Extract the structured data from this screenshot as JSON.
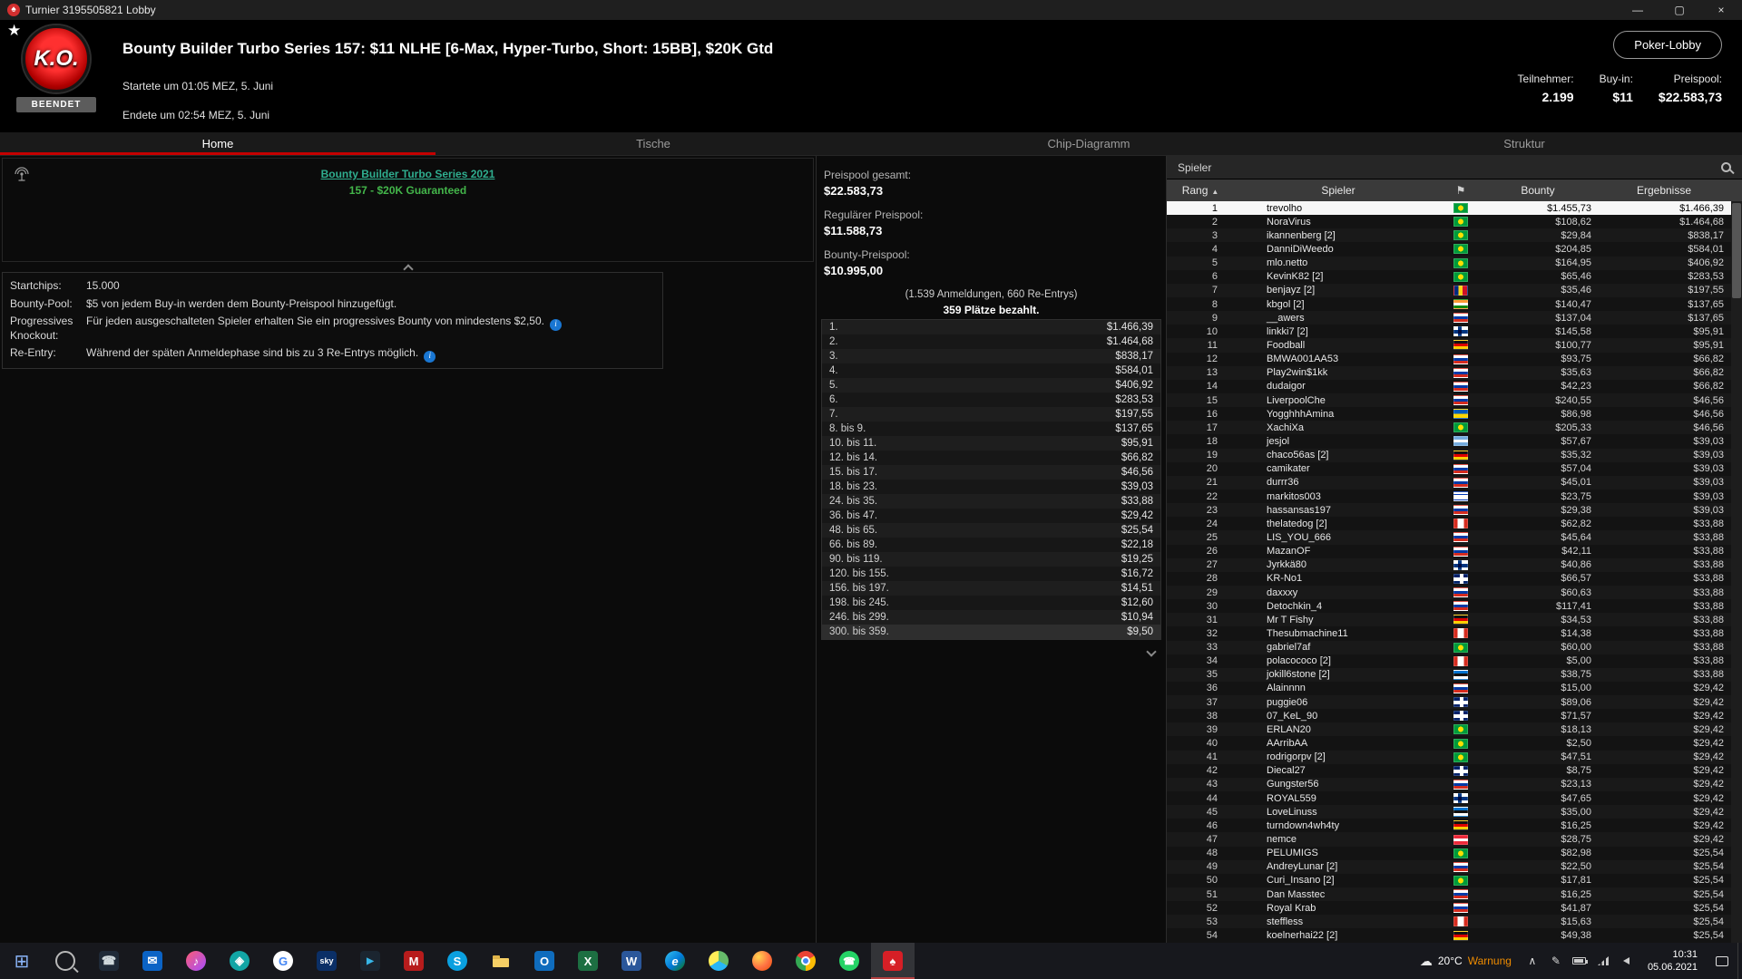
{
  "titlebar": {
    "title": "Turnier 3195505821 Lobby",
    "minimize": "—",
    "maximize": "▢",
    "close": "×"
  },
  "header": {
    "logo_text": "K.O.",
    "badge": "BEENDET",
    "title": "Bounty Builder Turbo Series 157: $11 NLHE [6-Max, Hyper-Turbo, Short: 15BB], $20K Gtd",
    "started": "Startete um 01:05 MEZ, 5. Juni",
    "ended": "Endete um 02:54 MEZ, 5. Juni",
    "lobby_button": "Poker-Lobby",
    "stats": [
      {
        "label": "Teilnehmer:",
        "value": "2.199"
      },
      {
        "label": "Buy-in:",
        "value": "$11"
      },
      {
        "label": "Preispool:",
        "value": "$22.583,73"
      }
    ]
  },
  "tabs": [
    {
      "label": "Home",
      "active": true
    },
    {
      "label": "Tische",
      "active": false
    },
    {
      "label": "Chip-Diagramm",
      "active": false
    },
    {
      "label": "Struktur",
      "active": false
    }
  ],
  "ad": {
    "line1": "Bounty Builder Turbo Series 2021",
    "line2": "157 - $20K Guaranteed"
  },
  "info": {
    "rows": [
      {
        "label": "Startchips:",
        "value": "15.000",
        "info": false
      },
      {
        "label": "Bounty-Pool:",
        "value": "$5 von jedem Buy-in werden dem Bounty-Preispool hinzugefügt.",
        "info": false
      },
      {
        "label": "Progressives Knockout:",
        "value": "Für jeden ausgeschalteten Spieler erhalten Sie ein progressives Bounty von mindestens $2,50.",
        "info": true
      },
      {
        "label": "Re-Entry:",
        "value": "Während der späten Anmeldephase sind bis zu 3 Re-Entrys möglich.",
        "info": true
      }
    ]
  },
  "prizepool": {
    "total_label": "Preispool gesamt:",
    "total": "$22.583,73",
    "regular_label": "Regulärer Preispool:",
    "regular": "$11.588,73",
    "bounty_label": "Bounty-Preispool:",
    "bounty": "$10.995,00",
    "entries": "(1.539 Anmeldungen, 660 Re-Entrys)",
    "paid": "359 Plätze bezahlt.",
    "payouts": [
      {
        "place": "1.",
        "amount": "$1.466,39"
      },
      {
        "place": "2.",
        "amount": "$1.464,68"
      },
      {
        "place": "3.",
        "amount": "$838,17"
      },
      {
        "place": "4.",
        "amount": "$584,01"
      },
      {
        "place": "5.",
        "amount": "$406,92"
      },
      {
        "place": "6.",
        "amount": "$283,53"
      },
      {
        "place": "7.",
        "amount": "$197,55"
      },
      {
        "place": "8. bis 9.",
        "amount": "$137,65"
      },
      {
        "place": "10. bis 11.",
        "amount": "$95,91"
      },
      {
        "place": "12. bis 14.",
        "amount": "$66,82"
      },
      {
        "place": "15. bis 17.",
        "amount": "$46,56"
      },
      {
        "place": "18. bis 23.",
        "amount": "$39,03"
      },
      {
        "place": "24. bis 35.",
        "amount": "$33,88"
      },
      {
        "place": "36. bis 47.",
        "amount": "$29,42"
      },
      {
        "place": "48. bis 65.",
        "amount": "$25,54"
      },
      {
        "place": "66. bis 89.",
        "amount": "$22,18"
      },
      {
        "place": "90. bis 119.",
        "amount": "$19,25"
      },
      {
        "place": "120. bis 155.",
        "amount": "$16,72"
      },
      {
        "place": "156. bis 197.",
        "amount": "$14,51"
      },
      {
        "place": "198. bis 245.",
        "amount": "$12,60"
      },
      {
        "place": "246. bis 299.",
        "amount": "$10,94"
      },
      {
        "place": "300. bis 359.",
        "amount": "$9,50",
        "highlight": true
      }
    ]
  },
  "players": {
    "panel_title": "Spieler",
    "columns": {
      "rank": "Rang",
      "player": "Spieler",
      "bounty": "Bounty",
      "results": "Ergebnisse"
    },
    "rows": [
      {
        "rank": 1,
        "name": "trevolho",
        "flag": "br",
        "bounty": "$1.455,73",
        "result": "$1.466,39",
        "selected": true
      },
      {
        "rank": 2,
        "name": "NoraVirus",
        "flag": "br",
        "bounty": "$108,62",
        "result": "$1.464,68"
      },
      {
        "rank": 3,
        "name": "ikannenberg [2]",
        "flag": "br",
        "bounty": "$29,84",
        "result": "$838,17"
      },
      {
        "rank": 4,
        "name": "DanniDiWeedo",
        "flag": "br",
        "bounty": "$204,85",
        "result": "$584,01"
      },
      {
        "rank": 5,
        "name": "mlo.netto",
        "flag": "br",
        "bounty": "$164,95",
        "result": "$406,92"
      },
      {
        "rank": 6,
        "name": "KevinK82 [2]",
        "flag": "br",
        "bounty": "$65,46",
        "result": "$283,53"
      },
      {
        "rank": 7,
        "name": "benjayz [2]",
        "flag": "ro",
        "bounty": "$35,46",
        "result": "$197,55"
      },
      {
        "rank": 8,
        "name": "kbgol [2]",
        "flag": "in",
        "bounty": "$140,47",
        "result": "$137,65"
      },
      {
        "rank": 9,
        "name": "__awers",
        "flag": "ru",
        "bounty": "$137,04",
        "result": "$137,65"
      },
      {
        "rank": 10,
        "name": "linkki7 [2]",
        "flag": "fi",
        "bounty": "$145,58",
        "result": "$95,91"
      },
      {
        "rank": 11,
        "name": "Foodball",
        "flag": "de",
        "bounty": "$100,77",
        "result": "$95,91"
      },
      {
        "rank": 12,
        "name": "BMWA001AA53",
        "flag": "ru",
        "bounty": "$93,75",
        "result": "$66,82"
      },
      {
        "rank": 13,
        "name": "Play2win$1kk",
        "flag": "ru",
        "bounty": "$35,63",
        "result": "$66,82"
      },
      {
        "rank": 14,
        "name": "dudaigor",
        "flag": "ru",
        "bounty": "$42,23",
        "result": "$66,82"
      },
      {
        "rank": 15,
        "name": "LiverpoolChe",
        "flag": "ru",
        "bounty": "$240,55",
        "result": "$46,56"
      },
      {
        "rank": 16,
        "name": "YogghhhAmina",
        "flag": "ua",
        "bounty": "$86,98",
        "result": "$46,56"
      },
      {
        "rank": 17,
        "name": "XachiXa",
        "flag": "br",
        "bounty": "$205,33",
        "result": "$46,56"
      },
      {
        "rank": 18,
        "name": "jesjol",
        "flag": "ar",
        "bounty": "$57,67",
        "result": "$39,03"
      },
      {
        "rank": 19,
        "name": "chaco56as [2]",
        "flag": "de",
        "bounty": "$35,32",
        "result": "$39,03"
      },
      {
        "rank": 20,
        "name": "camikater",
        "flag": "ru",
        "bounty": "$57,04",
        "result": "$39,03"
      },
      {
        "rank": 21,
        "name": "durrr36",
        "flag": "ru",
        "bounty": "$45,01",
        "result": "$39,03"
      },
      {
        "rank": 22,
        "name": "markitos003",
        "flag": "il",
        "bounty": "$23,75",
        "result": "$39,03"
      },
      {
        "rank": 23,
        "name": "hassansas197",
        "flag": "ru",
        "bounty": "$29,38",
        "result": "$39,03"
      },
      {
        "rank": 24,
        "name": "thelatedog [2]",
        "flag": "ca",
        "bounty": "$62,82",
        "result": "$33,88"
      },
      {
        "rank": 25,
        "name": "LIS_YOU_666",
        "flag": "ru",
        "bounty": "$45,64",
        "result": "$33,88"
      },
      {
        "rank": 26,
        "name": "MazanOF",
        "flag": "ru",
        "bounty": "$42,11",
        "result": "$33,88"
      },
      {
        "rank": 27,
        "name": "Jyrkkä80",
        "flag": "fi",
        "bounty": "$40,86",
        "result": "$33,88"
      },
      {
        "rank": 28,
        "name": "KR-No1",
        "flag": "gb",
        "bounty": "$66,57",
        "result": "$33,88"
      },
      {
        "rank": 29,
        "name": "daxxxy",
        "flag": "ru",
        "bounty": "$60,63",
        "result": "$33,88"
      },
      {
        "rank": 30,
        "name": "Detochkin_4",
        "flag": "ru",
        "bounty": "$117,41",
        "result": "$33,88"
      },
      {
        "rank": 31,
        "name": "Mr T Fishy",
        "flag": "de",
        "bounty": "$34,53",
        "result": "$33,88"
      },
      {
        "rank": 32,
        "name": "Thesubmachine11",
        "flag": "ca",
        "bounty": "$14,38",
        "result": "$33,88"
      },
      {
        "rank": 33,
        "name": "gabriel7af",
        "flag": "br",
        "bounty": "$60,00",
        "result": "$33,88"
      },
      {
        "rank": 34,
        "name": "polacococo [2]",
        "flag": "ca",
        "bounty": "$5,00",
        "result": "$33,88"
      },
      {
        "rank": 35,
        "name": "jokill6stone [2]",
        "flag": "ee",
        "bounty": "$38,75",
        "result": "$33,88"
      },
      {
        "rank": 36,
        "name": "Alainnnn",
        "flag": "ru",
        "bounty": "$15,00",
        "result": "$29,42"
      },
      {
        "rank": 37,
        "name": "puggie06",
        "flag": "gb",
        "bounty": "$89,06",
        "result": "$29,42"
      },
      {
        "rank": 38,
        "name": "07_KeL_90",
        "flag": "gb",
        "bounty": "$71,57",
        "result": "$29,42"
      },
      {
        "rank": 39,
        "name": "ERLAN20",
        "flag": "br",
        "bounty": "$18,13",
        "result": "$29,42"
      },
      {
        "rank": 40,
        "name": "AArribAA",
        "flag": "br",
        "bounty": "$2,50",
        "result": "$29,42"
      },
      {
        "rank": 41,
        "name": "rodrigorpv [2]",
        "flag": "br",
        "bounty": "$47,51",
        "result": "$29,42"
      },
      {
        "rank": 42,
        "name": "Diecal27",
        "flag": "gb",
        "bounty": "$8,75",
        "result": "$29,42"
      },
      {
        "rank": 43,
        "name": "Gungster56",
        "flag": "ru",
        "bounty": "$23,13",
        "result": "$29,42"
      },
      {
        "rank": 44,
        "name": "ROYAL559",
        "flag": "fi",
        "bounty": "$47,65",
        "result": "$29,42"
      },
      {
        "rank": 45,
        "name": "LoveLinuss",
        "flag": "ee",
        "bounty": "$35,00",
        "result": "$29,42"
      },
      {
        "rank": 46,
        "name": "turndown4wh4ty",
        "flag": "de",
        "bounty": "$16,25",
        "result": "$29,42"
      },
      {
        "rank": 47,
        "name": "nemce",
        "flag": "at",
        "bounty": "$28,75",
        "result": "$29,42"
      },
      {
        "rank": 48,
        "name": "PELUMIGS",
        "flag": "br",
        "bounty": "$82,98",
        "result": "$25,54"
      },
      {
        "rank": 49,
        "name": "AndreyLunar [2]",
        "flag": "ru",
        "bounty": "$22,50",
        "result": "$25,54"
      },
      {
        "rank": 50,
        "name": "Curi_Insano [2]",
        "flag": "br",
        "bounty": "$17,81",
        "result": "$25,54"
      },
      {
        "rank": 51,
        "name": "Dan Masstec",
        "flag": "ru",
        "bounty": "$16,25",
        "result": "$25,54"
      },
      {
        "rank": 52,
        "name": "Royal Krab",
        "flag": "ru",
        "bounty": "$41,87",
        "result": "$25,54"
      },
      {
        "rank": 53,
        "name": "steffless",
        "flag": "ca",
        "bounty": "$15,63",
        "result": "$25,54"
      },
      {
        "rank": 54,
        "name": "koelnerhai22 [2]",
        "flag": "de",
        "bounty": "$49,38",
        "result": "$25,54"
      }
    ]
  },
  "taskbar": {
    "icons": [
      {
        "name": "start-icon",
        "cls": "ic-start",
        "glyph": "⊞"
      },
      {
        "name": "taskbar-search-icon",
        "cls": "search-glyph"
      },
      {
        "name": "phone-icon",
        "glyph": "☎",
        "bg": "#1f2a38",
        "fg": "#cfd8dc",
        "square": true
      },
      {
        "name": "mail-icon",
        "glyph": "✉",
        "bg": "#0b63c5",
        "square": true
      },
      {
        "name": "music-icon",
        "glyph": "♪",
        "bg": "linear-gradient(135deg,#fb5c74,#a64dff)",
        "round": true
      },
      {
        "name": "webex-icon",
        "glyph": "◈",
        "bg": "#12a5a5",
        "round": true
      },
      {
        "name": "google-icon",
        "cls": "ic-google",
        "glyph": "G"
      },
      {
        "name": "sky-icon",
        "glyph": "sky",
        "bg": "#0b2f66",
        "square": true,
        "fs": 9
      },
      {
        "name": "prime-video-icon",
        "glyph": "▶",
        "bg": "#1b2530",
        "fg": "#37b6e8",
        "square": true,
        "fs": 10
      },
      {
        "name": "mail-red-icon",
        "glyph": "M",
        "bg": "#b71c1c",
        "square": true
      },
      {
        "name": "skype-icon",
        "glyph": "S",
        "bg": "#0aa0e0",
        "round": true
      },
      {
        "name": "file-explorer-icon",
        "cls": "ic-folder"
      },
      {
        "name": "outlook-icon",
        "glyph": "O",
        "bg": "#0f6cbd",
        "square": true
      },
      {
        "name": "excel-icon",
        "glyph": "X",
        "bg": "#1d6f42",
        "square": true
      },
      {
        "name": "word-icon",
        "glyph": "W",
        "bg": "#2b579a",
        "square": true
      },
      {
        "name": "edge-icon",
        "cls": "ic-edge",
        "glyph": "e"
      },
      {
        "name": "chromium-icon",
        "cls": "ic-chromium"
      },
      {
        "name": "firefox-icon",
        "cls": "ic-firefox"
      },
      {
        "name": "chrome-icon",
        "cls": "ic-chrome"
      },
      {
        "name": "whatsapp-icon",
        "glyph": "☎",
        "bg": "#25d366",
        "round": true,
        "fs": 11
      },
      {
        "name": "pokerstars-icon",
        "glyph": "♠",
        "bg": "#d61f26",
        "square": true,
        "active": true
      }
    ],
    "tray": {
      "temp": "20°C",
      "alert": "Warnung",
      "time": "10:31",
      "date": "05.06.2021"
    }
  }
}
